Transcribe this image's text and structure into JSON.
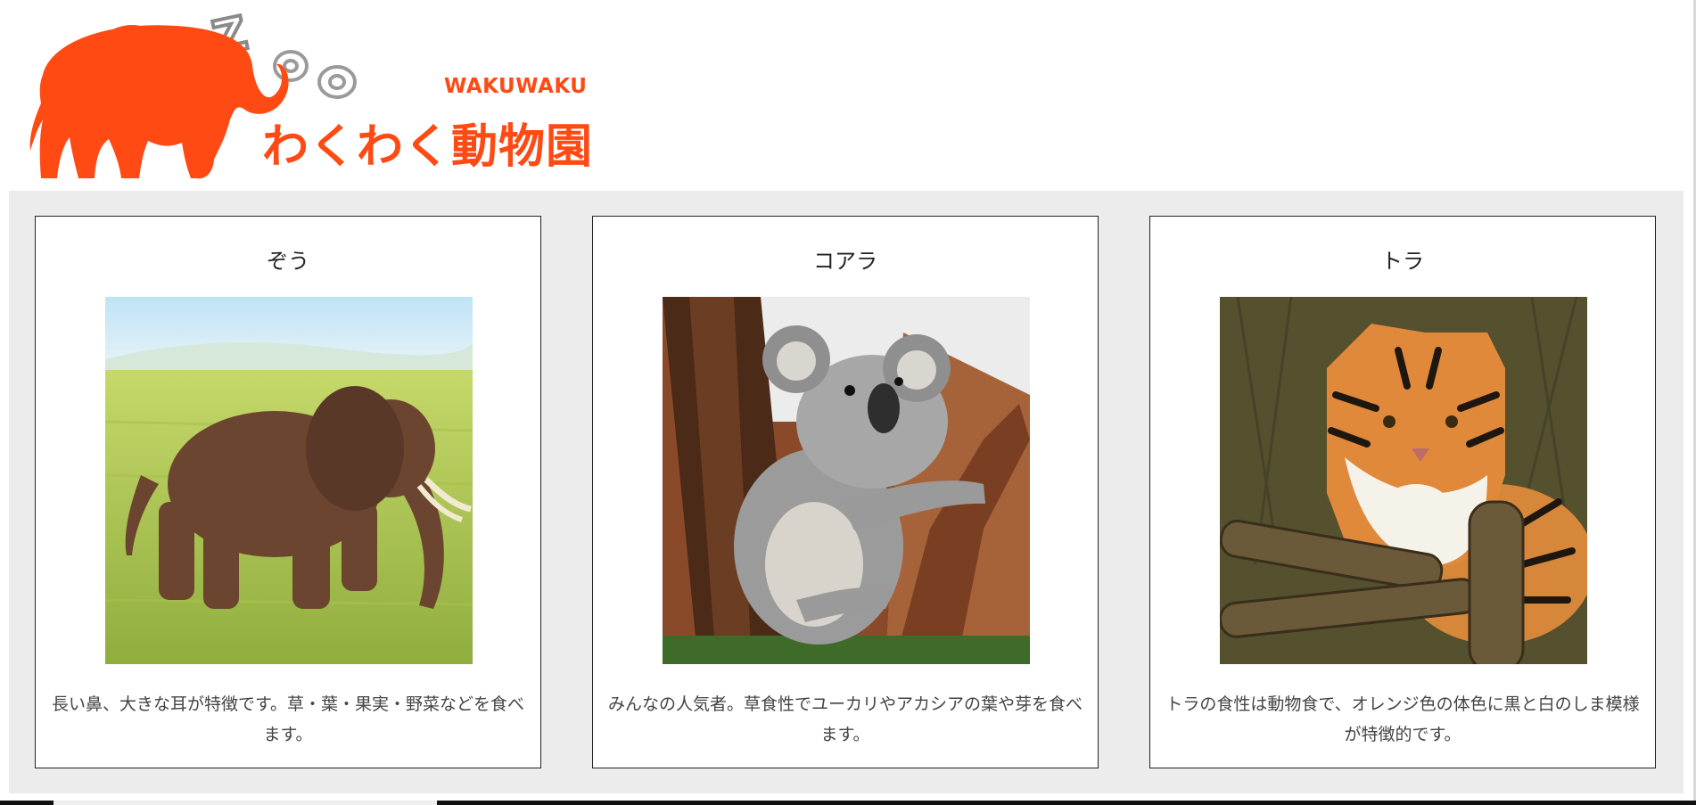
{
  "logo": {
    "zoo_text": "Zoo",
    "en_text": "WAKUWAKU",
    "ja_text": "わくわく動物園",
    "color": "#ff4a14"
  },
  "cards": [
    {
      "title": "ぞう",
      "image": "elephant-photo",
      "description": "長い鼻、大きな耳が特徴です。草・葉・果実・野菜などを食べます。"
    },
    {
      "title": "コアラ",
      "image": "koala-photo",
      "description": "みんなの人気者。草食性でユーカリやアカシアの葉や芽を食べます。"
    },
    {
      "title": "トラ",
      "image": "tiger-photo",
      "description": "トラの食性は動物食で、オレンジ色の体色に黒と白のしま模様が特徴的です。"
    }
  ]
}
